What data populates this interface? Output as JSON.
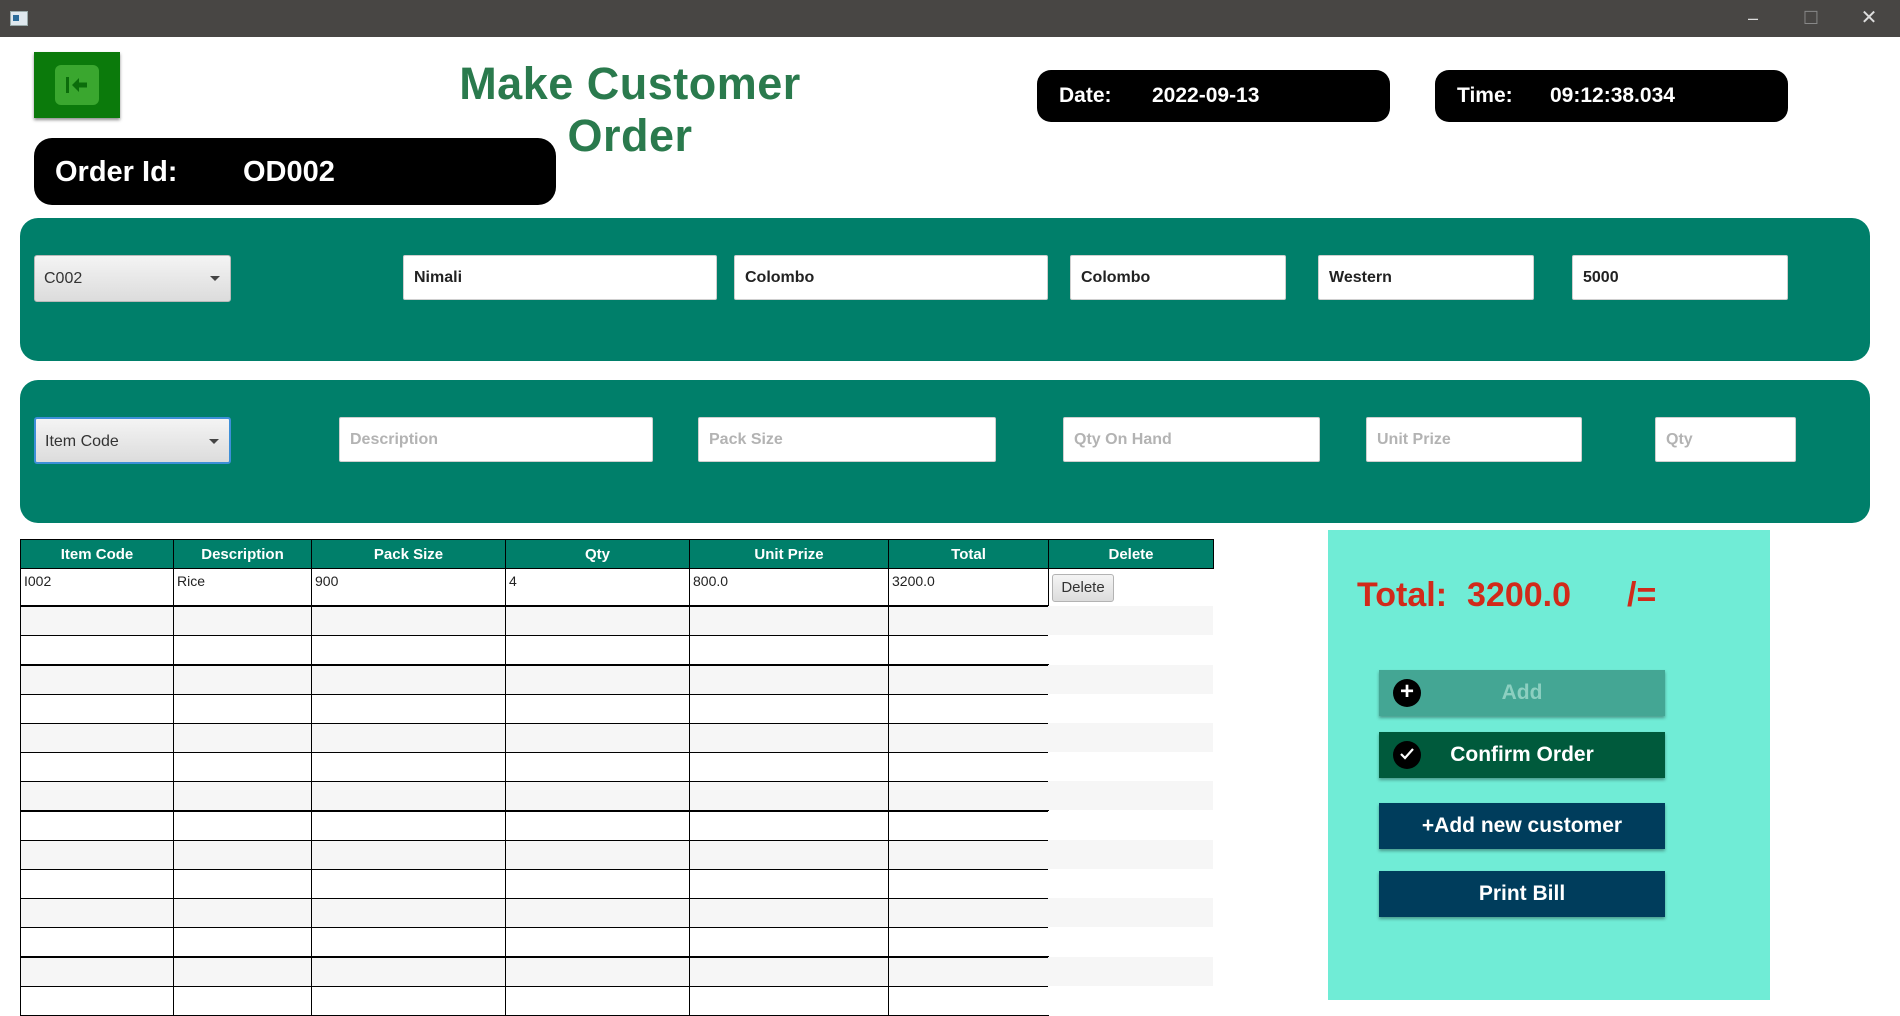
{
  "window": {
    "minimize": "–",
    "maximize": "☐",
    "close": "✕"
  },
  "header": {
    "title": "Make Customer Order",
    "date_label": "Date:",
    "date_value": "2022-09-13",
    "time_label": "Time:",
    "time_value": "09:12:38.034",
    "order_label": "Order Id:",
    "order_value": "OD002",
    "back_icon": "back-arrow-icon"
  },
  "customer": {
    "id": "C002",
    "name": "Nimali",
    "address": "Colombo",
    "city": "Colombo",
    "province": "Western",
    "postal_code": "5000"
  },
  "item": {
    "code_placeholder": "Item Code",
    "description_placeholder": "Description",
    "pack_size_placeholder": "Pack Size",
    "qty_on_hand_placeholder": "Qty On Hand",
    "unit_prize_placeholder": "Unit Prize",
    "qty_placeholder": "Qty"
  },
  "table": {
    "columns": [
      "Item Code",
      "Description",
      "Pack Size",
      "Qty",
      "Unit Prize",
      "Total",
      "Delete"
    ],
    "rows": [
      {
        "item_code": "I002",
        "description": "Rice",
        "pack_size": "900",
        "qty": "4",
        "unit_prize": "800.0",
        "total": "3200.0",
        "delete_label": "Delete"
      }
    ]
  },
  "summary": {
    "total_label": "Total:",
    "total_value": "3200.0",
    "total_unit": "/="
  },
  "actions": {
    "add": "Add",
    "confirm": "Confirm Order",
    "add_customer": "+Add new customer",
    "print": "Print Bill"
  },
  "colors": {
    "panel": "#007f6a",
    "side_panel": "#70ecd6",
    "title": "#2a7a4d",
    "total": "#d12a1a"
  }
}
